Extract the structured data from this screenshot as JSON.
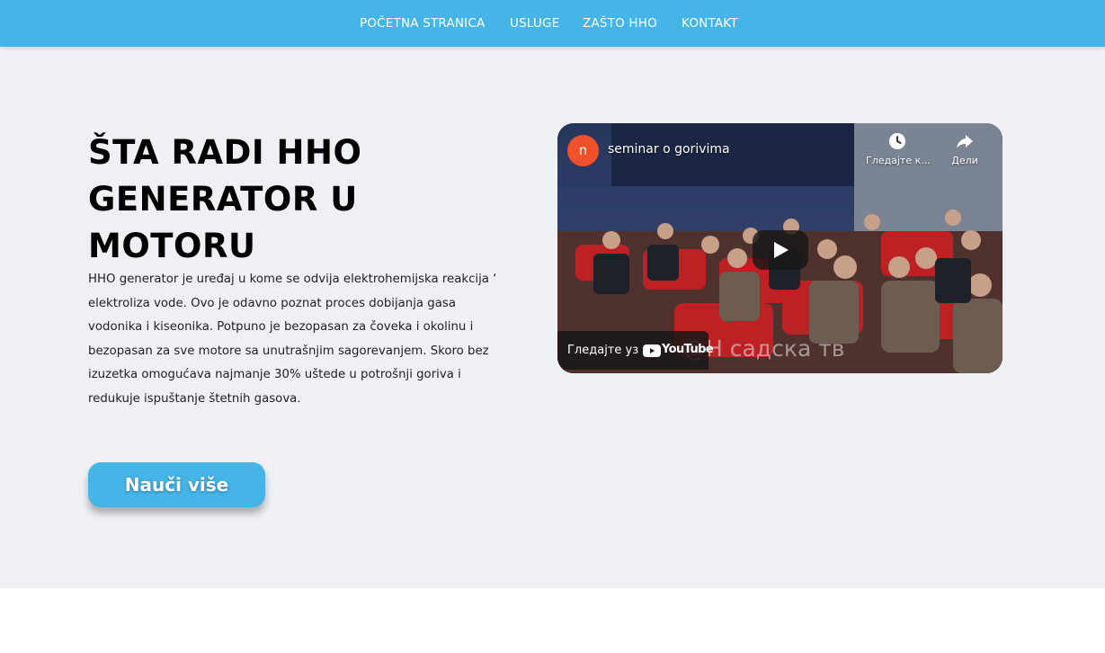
{
  "nav": {
    "items": [
      {
        "label": "POČETNA STRANICA"
      },
      {
        "label": "USLUGE"
      },
      {
        "label": "ZAŠTO HHO"
      },
      {
        "label": "KONTAKT"
      }
    ]
  },
  "hero": {
    "title": "ŠTA RADI HHO GENERATOR U MOTORU",
    "body": "HHO generator je uređaj u kome se odvija elektrohemijska reakcija ‘ elektroliza vode. Ovo je odavno poznat proces dobijanja gasa vodonika i kiseonika.  Potpuno je bezopasan za čoveka i okolinu i bezopasan za sve motore sa unutrašnjim sagorevanjem. Skoro bez izuzetka omogućava najmanje 30% uštede u potrošnji goriva i redukuje ispuštanje štetnih gasova.",
    "cta_label": "Nauči više"
  },
  "video": {
    "channel_initial": "n",
    "title": "seminar o gorivima",
    "watch_later_label": "Гледајте к...",
    "share_label": "Дели",
    "watch_on_label": "Гледајте уз",
    "youtube_label": "YouTube",
    "watermark": "@Н  садска тв"
  },
  "colors": {
    "accent": "#45b5e8",
    "hero_bg": "#eef0f4",
    "avatar": "#f0502a"
  },
  "icons": [
    "clock-icon",
    "share-icon",
    "play-icon",
    "youtube-logo-icon"
  ]
}
